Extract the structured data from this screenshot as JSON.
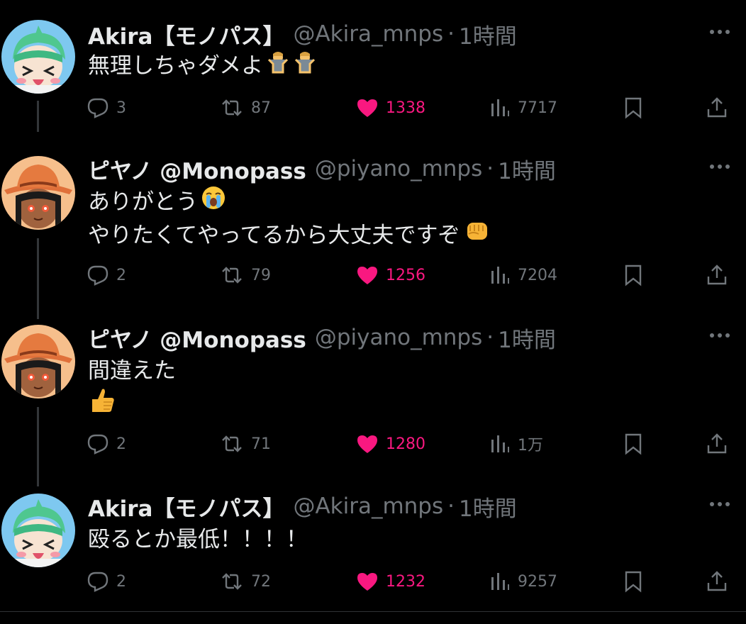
{
  "colors": {
    "background": "#000000",
    "text": "#e7e9ea",
    "muted": "#71767b",
    "like": "#f91880",
    "thread_line": "#333639"
  },
  "tweets": [
    {
      "name": "Akira【モノパス】",
      "handle": "@Akira_mnps",
      "time": "1時間",
      "lines": [
        "無理しちゃダメよ"
      ],
      "emojis": [
        "person-shrugging-emoji",
        "person-shrugging-emoji"
      ],
      "replies": "3",
      "retweets": "87",
      "likes": "1338",
      "views": "7717"
    },
    {
      "name": "ピヤノ @Monopass",
      "handle": "@piyano_mnps",
      "time": "1時間",
      "lines": [
        "ありがとう",
        "やりたくてやってるから大丈夫ですぞ"
      ],
      "emojis": [
        "loudly-crying-face-emoji",
        "oncoming-fist-emoji"
      ],
      "replies": "2",
      "retweets": "79",
      "likes": "1256",
      "views": "7204"
    },
    {
      "name": "ピヤノ @Monopass",
      "handle": "@piyano_mnps",
      "time": "1時間",
      "lines": [
        "間違えた"
      ],
      "emojis": [
        "thumbs-up-emoji"
      ],
      "replies": "2",
      "retweets": "71",
      "likes": "1280",
      "views": "1万"
    },
    {
      "name": "Akira【モノパス】",
      "handle": "@Akira_mnps",
      "time": "1時間",
      "lines": [
        "殴るとか最低！！！！"
      ],
      "emojis": [],
      "replies": "2",
      "retweets": "72",
      "likes": "1232",
      "views": "9257"
    }
  ],
  "separator": "·"
}
